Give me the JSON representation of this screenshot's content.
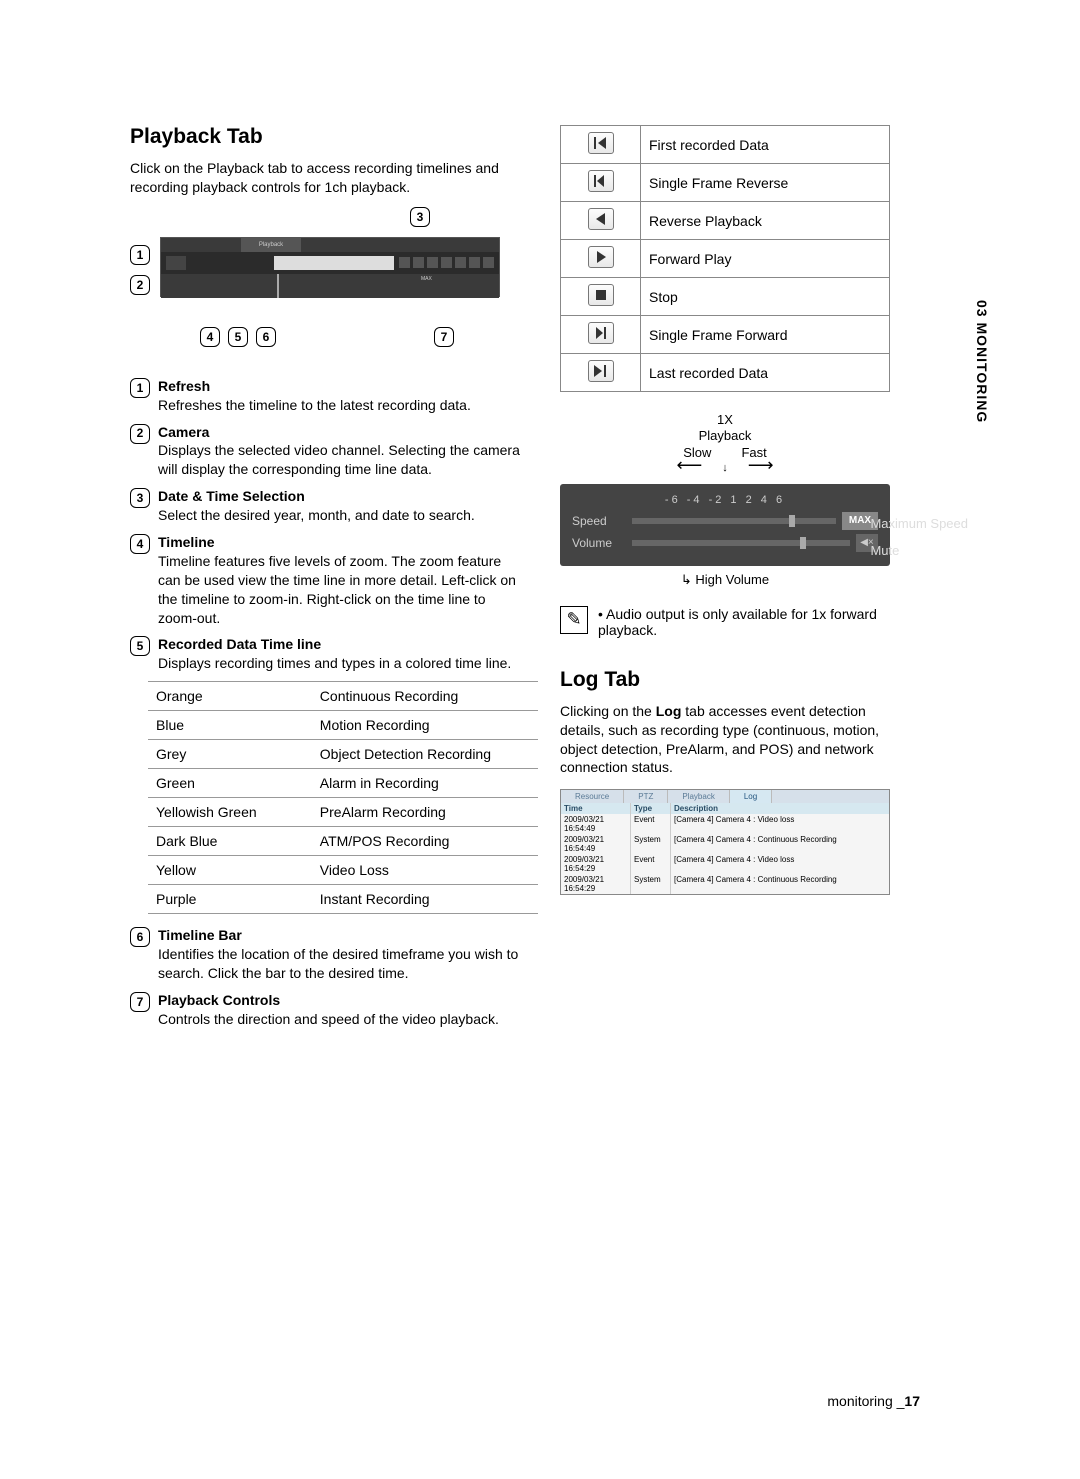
{
  "section_side": "03 MONITORING",
  "playback": {
    "heading": "Playback Tab",
    "intro": "Click on the Playback tab to access recording timelines and recording playback controls for 1ch playback.",
    "shot_tab": "Playback",
    "items": [
      {
        "n": "1",
        "title": "Refresh",
        "desc": "Refreshes the timeline to the latest recording data."
      },
      {
        "n": "2",
        "title": "Camera",
        "desc": "Displays the selected video channel. Selecting the camera will display the corresponding time line data."
      },
      {
        "n": "3",
        "title": "Date & Time Selection",
        "desc": "Select the desired year, month, and date to search."
      },
      {
        "n": "4",
        "title": "Timeline",
        "desc": "Timeline features five levels of zoom. The zoom feature can be used  view the time line in more detail. Left-click on the timeline to zoom-in. Right-click on the time line to zoom-out."
      },
      {
        "n": "5",
        "title": "Recorded Data Time line",
        "desc": "Displays recording times and types in a colored time line."
      },
      {
        "n": "6",
        "title": "Timeline Bar",
        "desc": "Identifies the location of the desired timeframe you wish to search. Click the bar to the desired time."
      },
      {
        "n": "7",
        "title": "Playback Controls",
        "desc": "Controls the direction and speed of the video playback."
      }
    ],
    "colors": [
      {
        "c": "Orange",
        "d": "Continuous Recording"
      },
      {
        "c": "Blue",
        "d": "Motion Recording"
      },
      {
        "c": "Grey",
        "d": "Object Detection Recording"
      },
      {
        "c": "Green",
        "d": "Alarm in Recording"
      },
      {
        "c": "Yellowish Green",
        "d": "PreAlarm Recording"
      },
      {
        "c": "Dark Blue",
        "d": "ATM/POS Recording"
      },
      {
        "c": "Yellow",
        "d": "Video Loss"
      },
      {
        "c": "Purple",
        "d": "Instant Recording"
      }
    ]
  },
  "controls": [
    {
      "label": "First recorded Data"
    },
    {
      "label": "Single Frame Reverse"
    },
    {
      "label": "Reverse Playback"
    },
    {
      "label": "Forward Play"
    },
    {
      "label": "Stop"
    },
    {
      "label": "Single Frame Forward"
    },
    {
      "label": "Last recorded Data"
    }
  ],
  "speed": {
    "x1": "1X",
    "pb": "Playback",
    "slow": "Slow",
    "fast": "Fast",
    "scale": "-6  -4  -2   1   2   4   6",
    "speed_lbl": "Speed",
    "volume_lbl": "Volume",
    "max": "MAX",
    "max_side": "Maximum Speed",
    "mute_side": "Mute",
    "high_volume": "High Volume"
  },
  "note": "Audio output is only available for 1x forward playback.",
  "log": {
    "heading": "Log Tab",
    "intro_a": "Clicking on the ",
    "intro_b": "Log",
    "intro_c": " tab accesses event detection details, such as recording type (continuous, motion, object detection, PreAlarm, and POS) and network connection status.",
    "shot": {
      "tabs": [
        "Resource",
        "PTZ",
        "Playback",
        "Log"
      ],
      "headers": [
        "Time",
        "Type",
        "Description"
      ],
      "rows": [
        [
          "2009/03/21 16:54:49",
          "Event",
          "[Camera 4] Camera 4 : Video loss"
        ],
        [
          "2009/03/21 16:54:49",
          "System",
          "[Camera 4] Camera 4 : Continuous Recording"
        ],
        [
          "2009/03/21 16:54:29",
          "Event",
          "[Camera 4] Camera 4 : Video loss"
        ],
        [
          "2009/03/21 16:54:29",
          "System",
          "[Camera 4] Camera 4 : Continuous Recording"
        ]
      ]
    }
  },
  "footer": {
    "label": "monitoring _",
    "page": "17"
  }
}
